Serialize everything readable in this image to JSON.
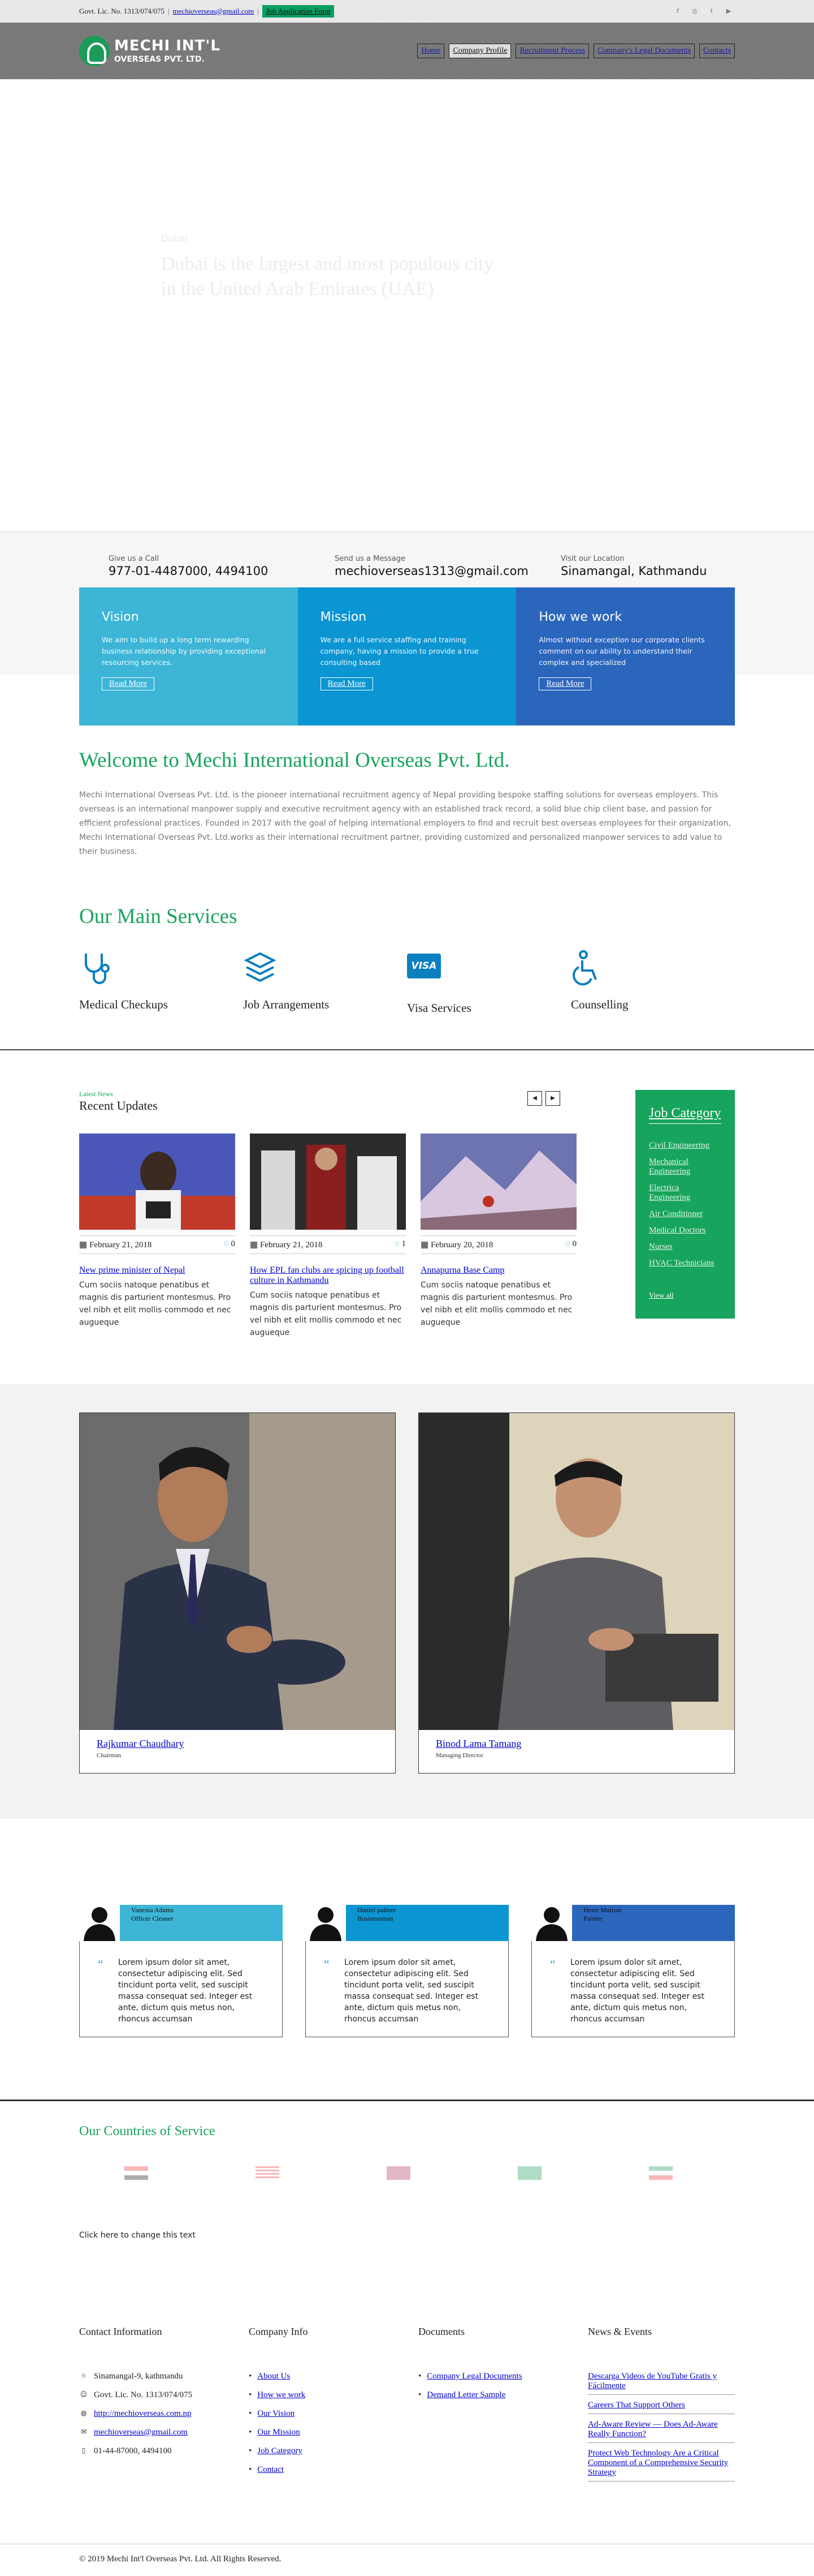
{
  "topbar": {
    "license": "Govt. Lic. No. 1313/074/075",
    "email": "mechioverseas@gmail.com",
    "apply_label": "Job Application Form",
    "social": [
      {
        "icon": "facebook-icon",
        "glyph": "f",
        "color": "#777"
      },
      {
        "icon": "instagram-icon",
        "glyph": "◎",
        "color": "#777"
      },
      {
        "icon": "twitter-icon",
        "glyph": "t",
        "color": "#777"
      },
      {
        "icon": "youtube-icon",
        "glyph": "▶",
        "color": "#777"
      }
    ]
  },
  "header": {
    "logo_line1": "MECHI INT'L",
    "logo_line2": "OVERSEAS PVT. LTD.",
    "nav": [
      "Home",
      "Company Profile",
      "Recruitment Process",
      "Company's Legal Documents",
      "Contacts"
    ]
  },
  "hero": {
    "kicker": "Dubai",
    "headline": "Dubai is the largest and most populous city in the United Arab Emirates (UAE)"
  },
  "contact_strip": {
    "call_label": "Give us a Call",
    "call_value": "977-01-4487000, 4494100",
    "msg_label": "Send us a Message",
    "msg_value": "mechioverseas1313@gmail.com",
    "loc_label": "Visit our Location",
    "loc_value": "Sinamangal, Kathmandu"
  },
  "pillars": [
    {
      "title": "Vision",
      "text": "We aim to build up a long term rewarding business relationship by providing exceptional resourcing services.",
      "button": "Read More",
      "color": "#3cb5d6"
    },
    {
      "title": "Mission",
      "text": "We are a full service staffing and training company, having a mission to provide a true consulting based",
      "button": "Read More",
      "color": "#0b95d2"
    },
    {
      "title": "How we work",
      "text": "Almost without exception our corporate clients comment on our ability to understand their complex and specialized",
      "button": "Read More",
      "color": "#2b66bd"
    }
  ],
  "welcome": {
    "title": "Welcome to Mechi International Overseas Pvt. Ltd.",
    "text": "Mechi International Overseas Pvt. Ltd. is the pioneer international recruitment agency of Nepal providing bespoke staffing solutions for overseas employers. This overseas is an international manpower supply and executive recruitment agency with an established track record, a solid blue chip client base, and passion for efficient professional practices. Founded in 2017 with the goal of helping international employers to find and recruit best overseas employees for their organization, Mechi International Overseas Pvt. Ltd.works as their international recruitment partner, providing customized and personalized manpower services to add value to their business."
  },
  "services": {
    "title": "Our Main Services",
    "items": [
      {
        "label": "Medical Checkups",
        "icon": "stethoscope-icon"
      },
      {
        "label": "Job Arrangements",
        "icon": "layers-icon"
      },
      {
        "label": "Visa Services",
        "icon": "visa-card-icon",
        "badge": "VISA"
      },
      {
        "label": "Counselling",
        "icon": "wheelchair-icon"
      }
    ]
  },
  "updates": {
    "kicker": "Latest News",
    "title": "Recent Updates",
    "posts": [
      {
        "date": "February 21, 2018",
        "comments": "0",
        "title": "New prime minister of Nepal",
        "excerpt": "Cum sociis natoque penatibus et magnis dis parturient montesmus. Pro vel nibh et elit mollis commodo et nec augueque"
      },
      {
        "date": "February 21, 2018",
        "comments": "1",
        "title": "How EPL fan clubs are spicing up football culture in Kathmandu",
        "excerpt": "Cum sociis natoque penatibus et magnis dis parturient montesmus. Pro vel nibh et elit mollis commodo et nec augueque"
      },
      {
        "date": "February 20, 2018",
        "comments": "0",
        "title": "Annapurna Base Camp",
        "excerpt": "Cum sociis natoque penatibus et magnis dis parturient montesmus. Pro vel nibh et elit mollis commodo et nec augueque"
      }
    ]
  },
  "job_category": {
    "title": "Job Category",
    "items": [
      "Civil Engineering",
      "Mechanical Engineering",
      "Electrica Engineering",
      "Air Conditioner",
      "Medical Doctors",
      "Nurses",
      "HVAC Technicians"
    ],
    "view_all": "View all"
  },
  "team": [
    {
      "name": "Rajkumar Chaudhary",
      "role": "Chairman"
    },
    {
      "name": "Binod Lama Tamang",
      "role": "Managing Director"
    }
  ],
  "testimonials": [
    {
      "name": "Vanessa Adams",
      "role": "Officer Cleaner",
      "text": "Lorem ipsum dolor sit amet, consectetur adipiscing elit. Sed tincidunt porta velit, sed suscipit massa consequat sed. Integer est ante, dictum quis metus non, rhoncus accumsan",
      "color": "#3cb5d6"
    },
    {
      "name": "Daniel palmer",
      "role": "Businessman",
      "text": "Lorem ipsum dolor sit amet, consectetur adipiscing elit. Sed tincidunt porta velit, sed suscipit massa consequat sed. Integer est ante, dictum quis metus non, rhoncus accumsan",
      "color": "#0b95d2"
    },
    {
      "name": "Henri Matisse",
      "role": "Painter",
      "text": "Lorem ipsum dolor sit amet, consectetur adipiscing elit. Sed tincidunt porta velit, sed suscipit massa consequat sed. Integer est ante, dictum quis metus non, rhoncus accumsan",
      "color": "#2b66bd"
    }
  ],
  "countries": {
    "title": "Our Countries of Service",
    "change_text": "Click here to change this text"
  },
  "footer": {
    "contact_title": "Contact Information",
    "address": "Sinamangal-9, kathmandu",
    "license": "Govt. Lic. No. 1313/074/075",
    "website": "http://mechioverseas.com.np",
    "email": "mechioverseas@gmail.com",
    "phone": "01-44-87000, 4494100",
    "company_title": "Company Info",
    "company_links": [
      "About Us",
      "How we work",
      "Our Vision",
      "Our Mission",
      "Job Category",
      "Contact"
    ],
    "docs_title": "Documents",
    "docs_links": [
      "Company Legal Documents",
      "Demand Letter Sample"
    ],
    "news_title": "News & Events",
    "news_links": [
      "Descarga Videos de YouTube Gratis y Fácilmente",
      "Careers That Support Others",
      "Ad-Aware Review — Does Ad-Aware Really Function?",
      "Protect Web Technology Are a Critical Component of a Comprehensive Security Strategy"
    ],
    "copyright": "© 2019 Mechi Int'l Overseas Pvt. Ltd. All Rights Reserved."
  }
}
